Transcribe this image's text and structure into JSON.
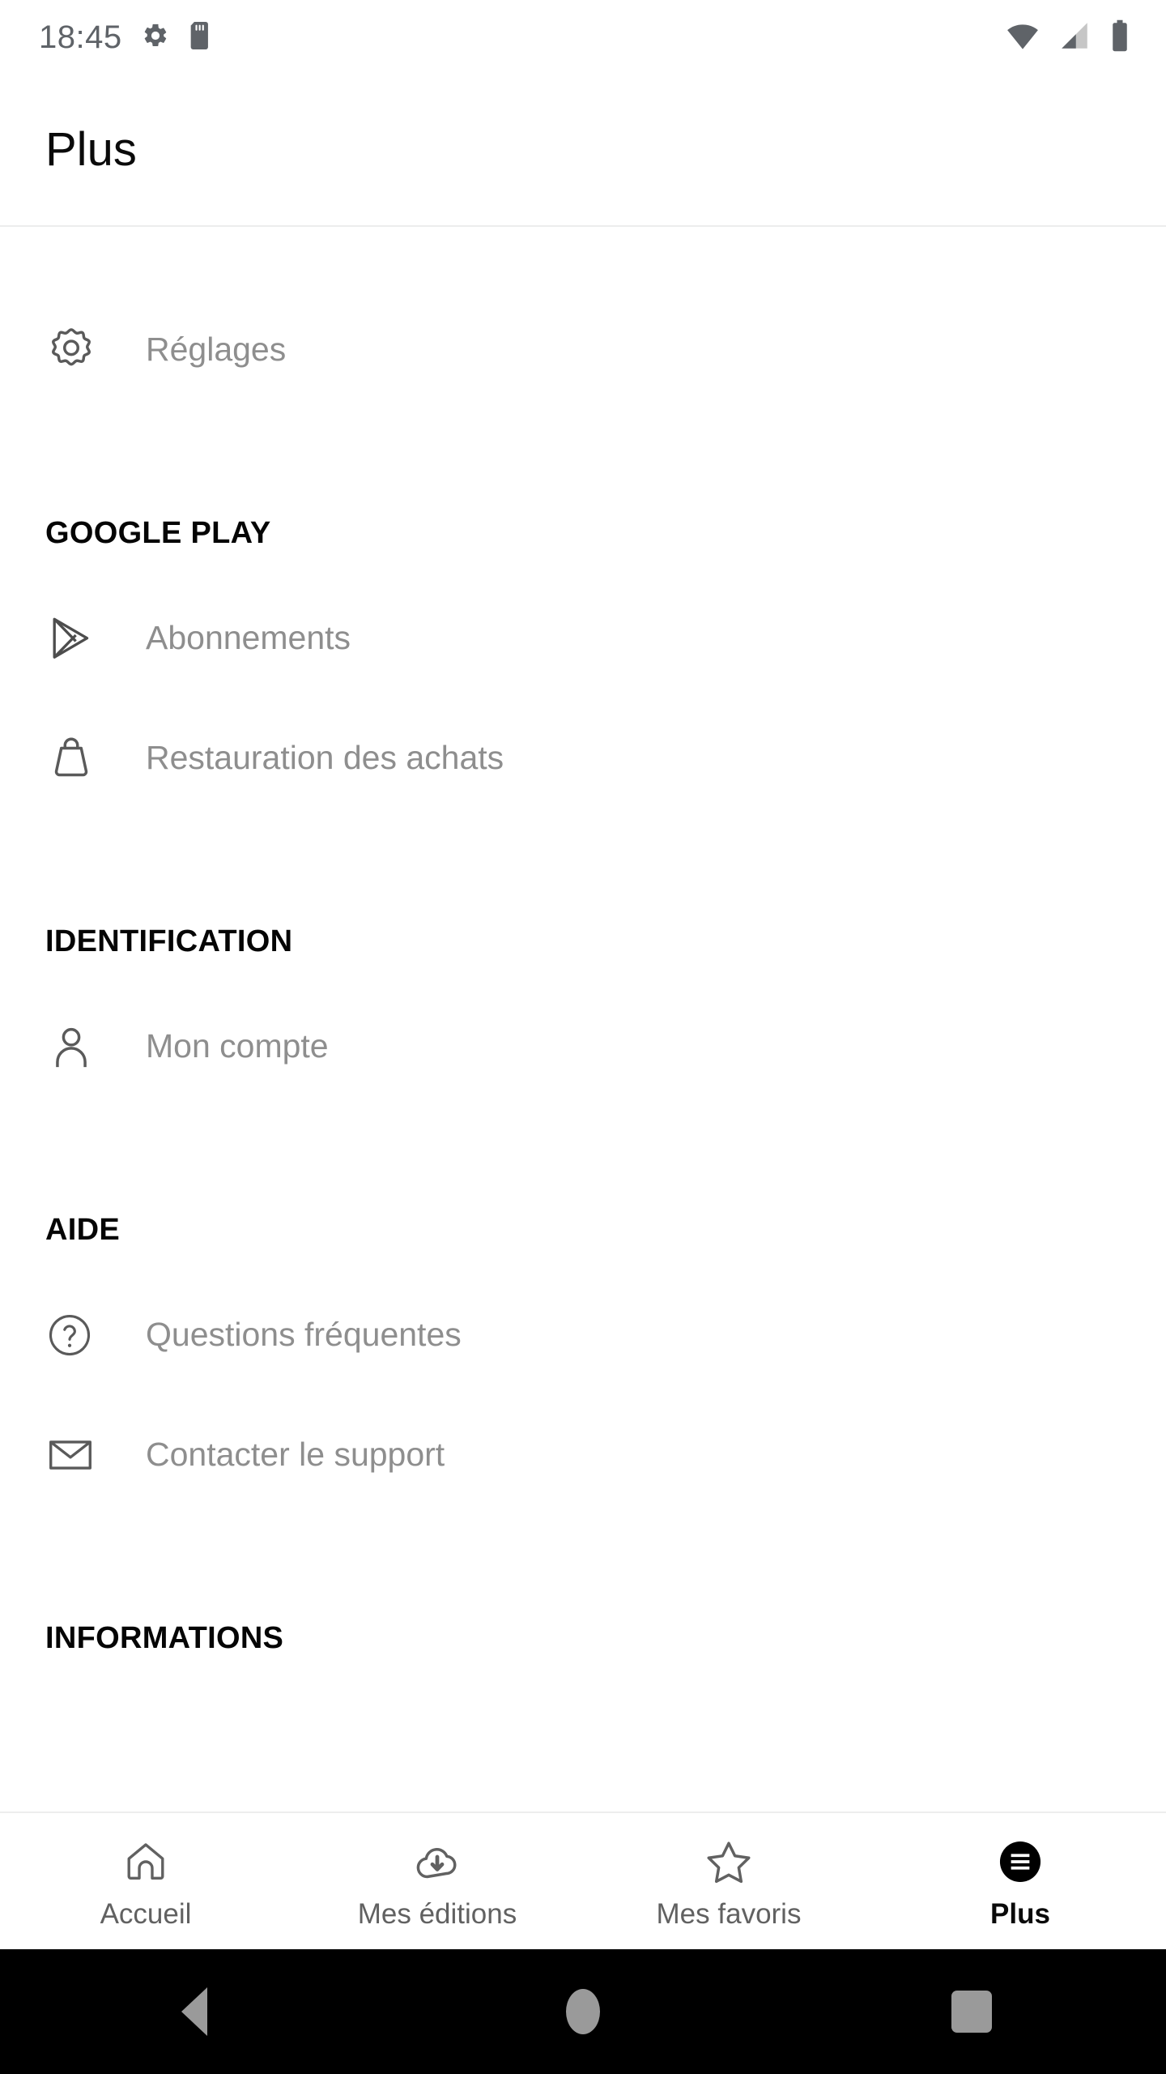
{
  "status_bar": {
    "time": "18:45",
    "icons": [
      "gear-icon",
      "sd-card-icon",
      "wifi-icon",
      "cellular-signal-icon",
      "battery-icon"
    ]
  },
  "app_bar": {
    "title": "Plus"
  },
  "content": {
    "top_items": [
      {
        "icon": "gear-icon",
        "label": "Réglages"
      }
    ],
    "sections": [
      {
        "header": "GOOGLE PLAY",
        "items": [
          {
            "icon": "google-play-icon",
            "label": "Abonnements"
          },
          {
            "icon": "shopping-bag-icon",
            "label": "Restauration des achats"
          }
        ]
      },
      {
        "header": "IDENTIFICATION",
        "items": [
          {
            "icon": "person-icon",
            "label": "Mon compte"
          }
        ]
      },
      {
        "header": "AIDE",
        "items": [
          {
            "icon": "question-circle-icon",
            "label": "Questions fréquentes"
          },
          {
            "icon": "envelope-icon",
            "label": "Contacter le support"
          }
        ]
      },
      {
        "header": "INFORMATIONS",
        "items": []
      }
    ]
  },
  "bottom_nav": {
    "items": [
      {
        "icon": "home-icon",
        "label": "Accueil",
        "active": false
      },
      {
        "icon": "cloud-download-icon",
        "label": "Mes éditions",
        "active": false
      },
      {
        "icon": "star-icon",
        "label": "Mes favoris",
        "active": false
      },
      {
        "icon": "hamburger-menu-icon",
        "label": "Plus",
        "active": true
      }
    ]
  },
  "system_nav": {
    "buttons": [
      "back-icon",
      "home-icon",
      "recents-icon"
    ]
  },
  "colors": {
    "background": "#ffffff",
    "label_gray": "#8e8e8e",
    "header_black": "#050505",
    "icon_stroke": "#5a5a5a",
    "status_gray": "#5f6368",
    "active_black": "#000000",
    "divider": "#ededed",
    "system_bar": "#000000",
    "system_icon": "#9a9a9a"
  }
}
